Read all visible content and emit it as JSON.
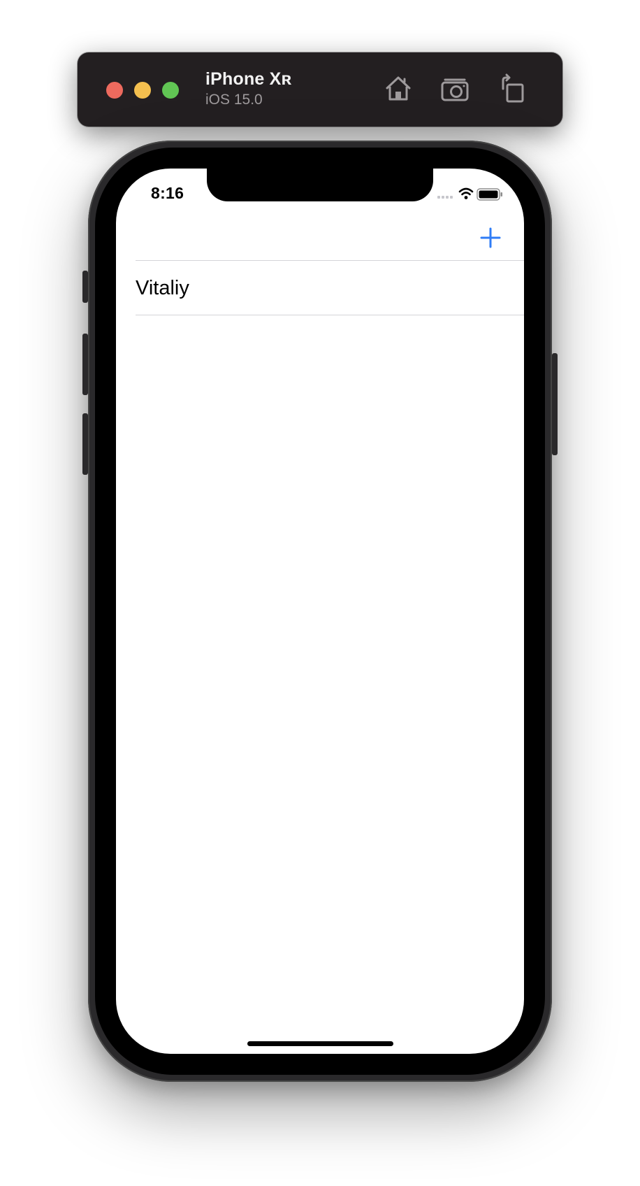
{
  "simulator": {
    "device_name": "iPhone Xʀ",
    "os_version": "iOS 15.0",
    "icons": [
      "home-icon",
      "screenshot-camera-icon",
      "rotate-icon"
    ]
  },
  "status_bar": {
    "time": "8:16",
    "icons": [
      "cellular-signal-icon",
      "wifi-icon",
      "battery-icon"
    ]
  },
  "nav_bar": {
    "add_icon": "plus-icon",
    "accent_color": "#2f7cf6"
  },
  "list": {
    "items": [
      {
        "label": "Vitaliy"
      }
    ]
  }
}
